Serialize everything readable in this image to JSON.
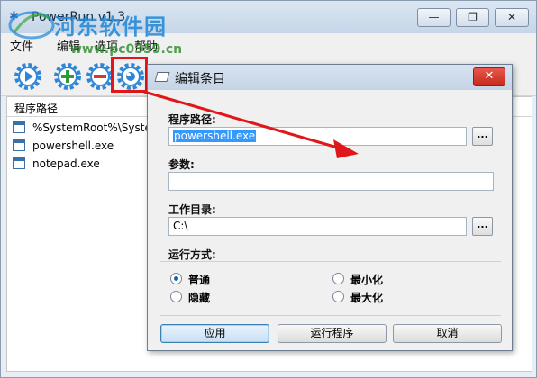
{
  "main_window": {
    "title": "PowerRun v1.3",
    "menu": [
      "文件",
      "编辑",
      "选项",
      "帮助"
    ],
    "window_buttons": {
      "minimize": "—",
      "maximize": "❐",
      "close": "✕"
    },
    "toolbar_icons": [
      "play-icon",
      "add-icon",
      "remove-icon",
      "edit-icon"
    ],
    "list": {
      "header": "程序路径",
      "items": [
        "%SystemRoot%\\System",
        "powershell.exe",
        "notepad.exe"
      ]
    }
  },
  "watermark": {
    "title": "河东软件园",
    "url": "www.pc0359.cn"
  },
  "dialog": {
    "title": "编辑条目",
    "close_glyph": "✕",
    "program_path": {
      "label": "程序路径:",
      "value": "powershell.exe"
    },
    "params": {
      "label": "参数:",
      "value": ""
    },
    "work_dir": {
      "label": "工作目录:",
      "value": "C:\\"
    },
    "browse_label": "...",
    "run_mode": {
      "label": "运行方式:",
      "options": [
        {
          "label": "普通",
          "checked": true
        },
        {
          "label": "最小化",
          "checked": false
        },
        {
          "label": "隐藏",
          "checked": false
        },
        {
          "label": "最大化",
          "checked": false
        }
      ]
    },
    "buttons": {
      "apply": "应用",
      "run": "运行程序",
      "cancel": "取消"
    }
  },
  "colors": {
    "highlight": "#e0161a",
    "selection": "#3399ff",
    "toolbar_icon_blue": "#2f86d6",
    "toolbar_icon_green": "#2f9a3a",
    "toolbar_icon_red": "#d23a2e"
  }
}
